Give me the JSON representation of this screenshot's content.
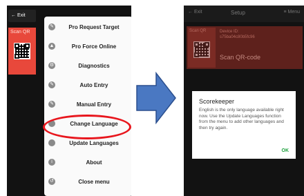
{
  "left_screen": {
    "exit_label": "← Exit",
    "scan_tile_label": "Scan QR",
    "menu_items": [
      {
        "icon": "edit-icon",
        "glyph": "✎",
        "label": "Pro Request Target"
      },
      {
        "icon": "up-arrow-icon",
        "glyph": "▲",
        "label": "Pro Force Online"
      },
      {
        "icon": "gear-icon",
        "glyph": "⚙",
        "label": "Diagnostics"
      },
      {
        "icon": "edit-icon",
        "glyph": "✎",
        "label": "Auto Entry"
      },
      {
        "icon": "edit-icon",
        "glyph": "✎",
        "label": "Manual Entry"
      },
      {
        "icon": "circle-icon",
        "glyph": "",
        "label": "Change Language"
      },
      {
        "icon": "circle-icon",
        "glyph": "",
        "label": "Update Languages"
      },
      {
        "icon": "info-icon",
        "glyph": "i",
        "label": "About"
      },
      {
        "icon": "back-icon",
        "glyph": "↺",
        "label": "Close menu"
      }
    ],
    "highlight_color": "#e8161d"
  },
  "arrow": {
    "color": "#4a78c2",
    "border": "#2b4f8e"
  },
  "right_screen": {
    "header": {
      "exit_label": "← Exit",
      "title": "Setup",
      "menu_label": "≡ Menu"
    },
    "scan_tile_label": "Scan QR",
    "device_line1": "Device ID:",
    "device_line2": "s75ba04c80b5fc96",
    "scan_text": "Scan QR-code",
    "dialog": {
      "title": "Scorekeeper",
      "body": "English is the only language available right now. Use the Update Languages function from the menu to add other languages and then try again.",
      "ok_label": "OK"
    }
  }
}
